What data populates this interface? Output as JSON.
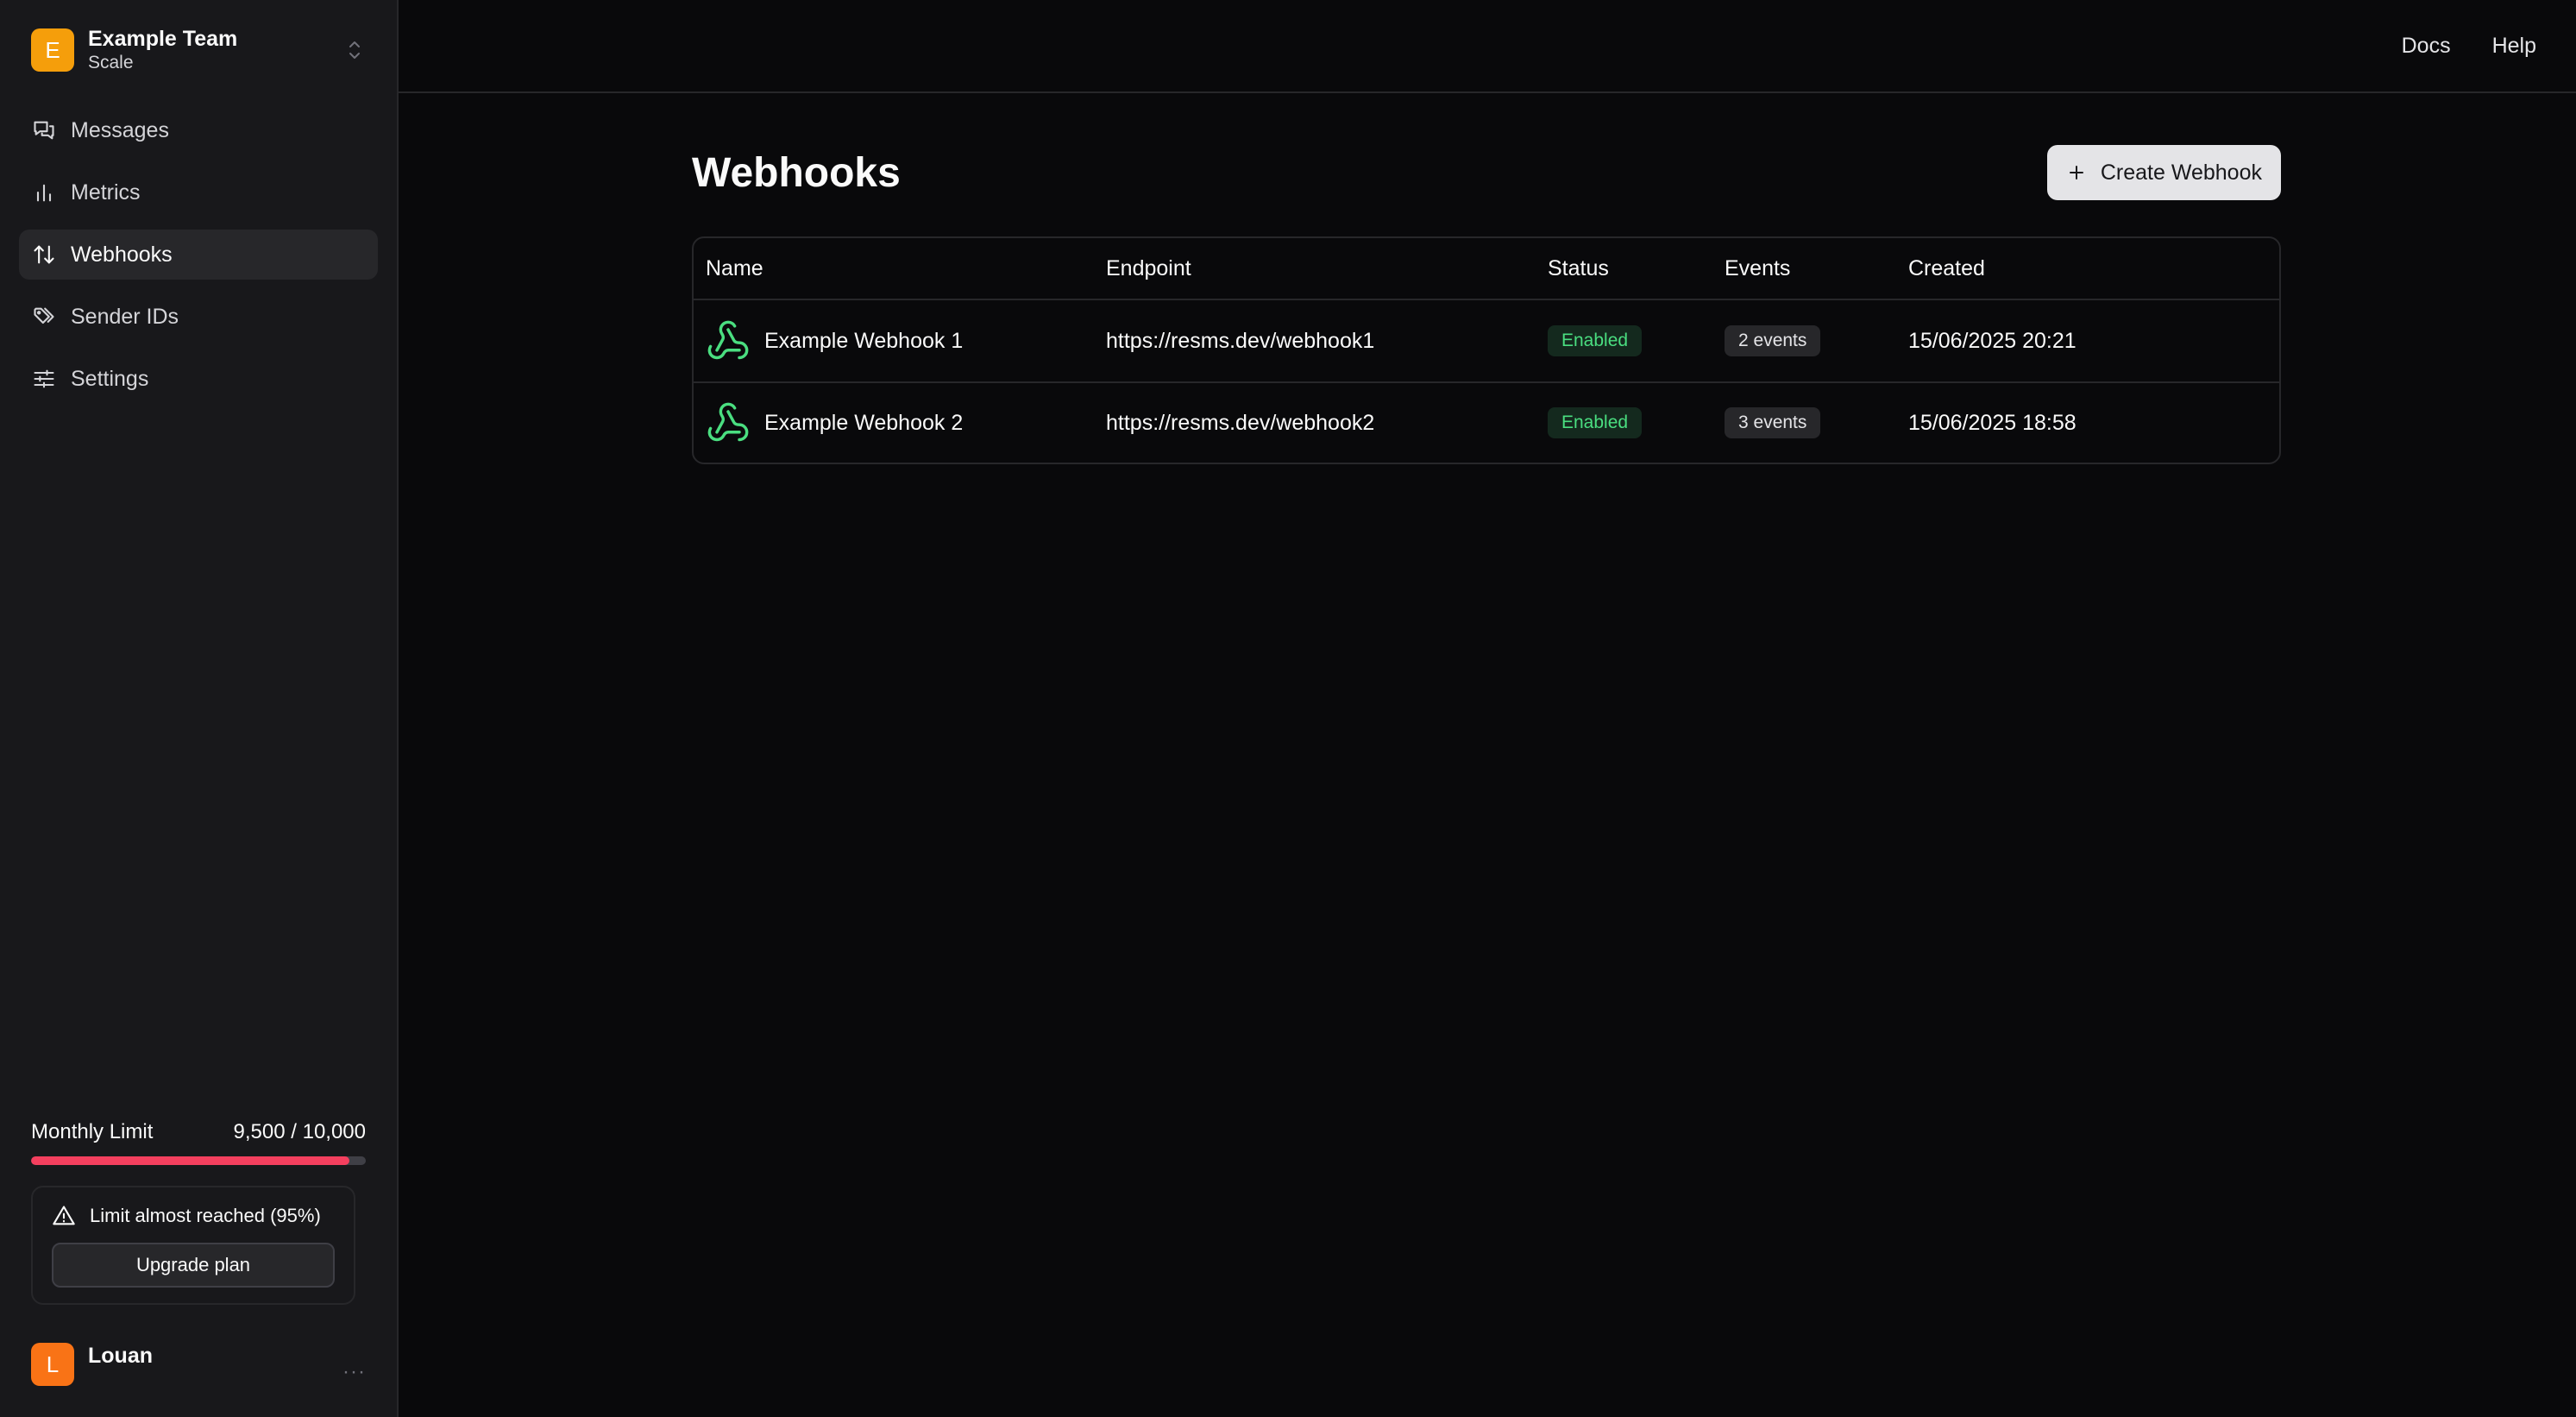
{
  "team": {
    "initial": "E",
    "name": "Example Team",
    "plan": "Scale"
  },
  "nav": [
    {
      "label": "Messages",
      "icon": "messages-icon"
    },
    {
      "label": "Metrics",
      "icon": "bar-chart-icon"
    },
    {
      "label": "Webhooks",
      "icon": "arrows-up-down-icon",
      "active": true
    },
    {
      "label": "Sender IDs",
      "icon": "tags-icon"
    },
    {
      "label": "Settings",
      "icon": "sliders-icon"
    }
  ],
  "usage": {
    "label": "Monthly Limit",
    "value": "9,500 / 10,000",
    "percent": 95
  },
  "alert": {
    "text": "Limit almost reached (95%)",
    "button": "Upgrade plan"
  },
  "user": {
    "initial": "L",
    "name": "Louan",
    "more": "···"
  },
  "topbar": {
    "docs": "Docs",
    "help": "Help"
  },
  "page": {
    "title": "Webhooks",
    "create_label": "Create Webhook"
  },
  "table": {
    "headers": {
      "name": "Name",
      "endpoint": "Endpoint",
      "status": "Status",
      "events": "Events",
      "created": "Created"
    },
    "rows": [
      {
        "name": "Example Webhook 1",
        "endpoint": "https://resms.dev/webhook1",
        "status": "Enabled",
        "events": "2 events",
        "created": "15/06/2025 20:21"
      },
      {
        "name": "Example Webhook 2",
        "endpoint": "https://resms.dev/webhook2",
        "status": "Enabled",
        "events": "3 events",
        "created": "15/06/2025 18:58"
      }
    ]
  },
  "colors": {
    "accent_green": "#4ade80",
    "limit_red": "#f43f5e",
    "team_avatar": "#f59e0b",
    "user_avatar": "#f97316"
  }
}
